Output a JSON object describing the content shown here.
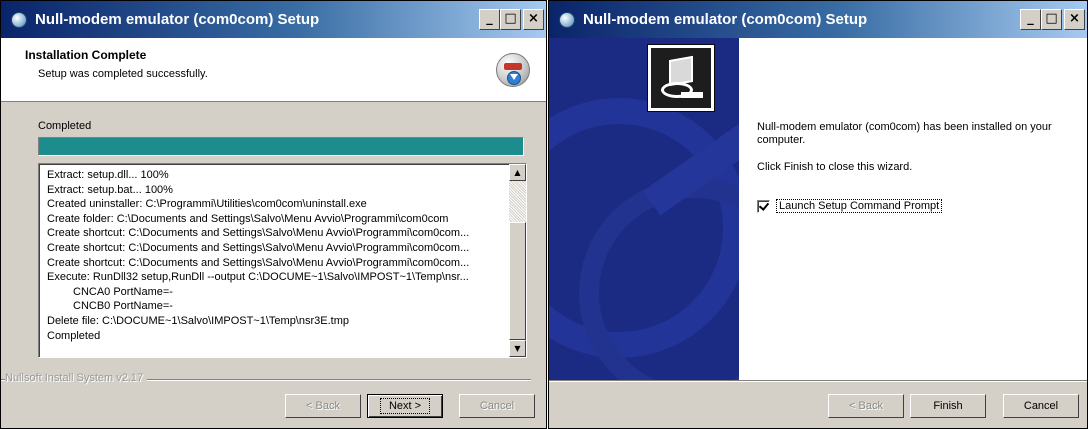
{
  "left_window": {
    "title": "Null-modem emulator (com0com) Setup",
    "title_buttons": {
      "minimize": "_",
      "maximize": "□",
      "close": "×"
    },
    "header": {
      "title": "Installation Complete",
      "subtitle": "Setup was completed successfully."
    },
    "status_label": "Completed",
    "progress": {
      "value_percent": 100,
      "color": "#1c8c8c"
    },
    "log": [
      "Extract: setup.dll... 100%",
      "Extract: setup.bat... 100%",
      "Created uninstaller: C:\\Programmi\\Utilities\\com0com\\uninstall.exe",
      "Create folder: C:\\Documents and Settings\\Salvo\\Menu Avvio\\Programmi\\com0com",
      "Create shortcut: C:\\Documents and Settings\\Salvo\\Menu Avvio\\Programmi\\com0com...",
      "Create shortcut: C:\\Documents and Settings\\Salvo\\Menu Avvio\\Programmi\\com0com...",
      "Create shortcut: C:\\Documents and Settings\\Salvo\\Menu Avvio\\Programmi\\com0com...",
      "Execute: RunDll32 setup,RunDll --output C:\\DOCUME~1\\Salvo\\IMPOST~1\\Temp\\nsr...",
      "CNCA0 PortName=-",
      "CNCB0 PortName=-",
      "Delete file: C:\\DOCUME~1\\Salvo\\IMPOST~1\\Temp\\nsr3E.tmp",
      "Completed"
    ],
    "branding": "Nullsoft Install System v2.17",
    "buttons": {
      "back": "< Back",
      "next": "Next >",
      "cancel": "Cancel"
    }
  },
  "right_window": {
    "title": "Null-modem emulator (com0com) Setup",
    "title_buttons": {
      "minimize": "_",
      "maximize": "□",
      "close": "×"
    },
    "message": "Null-modem emulator (com0com) has been installed on your computer.",
    "instruction": "Click Finish to close this wizard.",
    "checkbox": {
      "label": "Launch Setup Command Prompt",
      "checked": true
    },
    "buttons": {
      "back": "< Back",
      "finish": "Finish",
      "cancel": "Cancel"
    }
  },
  "colors": {
    "titlebar_start": "#0a246a",
    "titlebar_end": "#a6caf0",
    "dialog_face": "#d4d0c8",
    "side_panel": "#1b2a83"
  }
}
